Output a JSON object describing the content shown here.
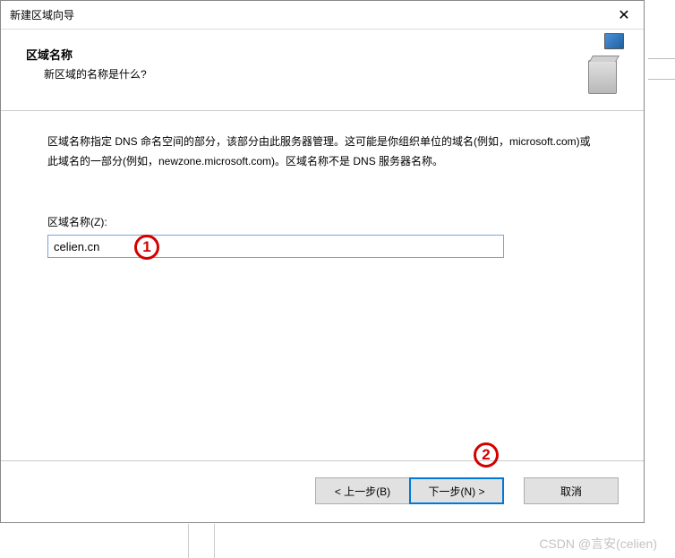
{
  "titlebar": {
    "title": "新建区域向导"
  },
  "header": {
    "title": "区域名称",
    "subtitle": "新区域的名称是什么?"
  },
  "content": {
    "description": "区域名称指定 DNS 命名空间的部分，该部分由此服务器管理。这可能是你组织单位的域名(例如，microsoft.com)或此域名的一部分(例如，newzone.microsoft.com)。区域名称不是 DNS 服务器名称。",
    "zone_label": "区域名称(Z):",
    "zone_value": "celien.cn"
  },
  "buttons": {
    "back": "< 上一步(B)",
    "next": "下一步(N) >",
    "cancel": "取消"
  },
  "annotations": {
    "badge1": "1",
    "badge2": "2"
  },
  "watermark": "CSDN @言安(celien)"
}
